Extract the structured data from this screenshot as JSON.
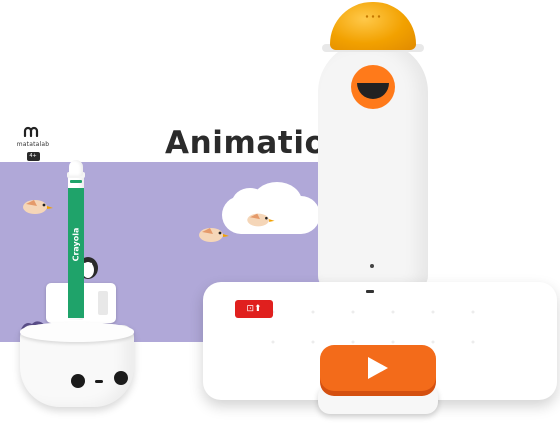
{
  "brand": {
    "name": "matatalab",
    "badge": "4+"
  },
  "headline": "Animation",
  "controller": {
    "red_button_label": "⊡⬆",
    "play_icon": "play-icon"
  },
  "crayon": {
    "brand_text": "Crayola"
  },
  "colors": {
    "banner": "#b0a8d8",
    "dome": "#f2a100",
    "play": "#f36b1a",
    "red": "#e0201e",
    "crayon": "#1fa36a"
  }
}
